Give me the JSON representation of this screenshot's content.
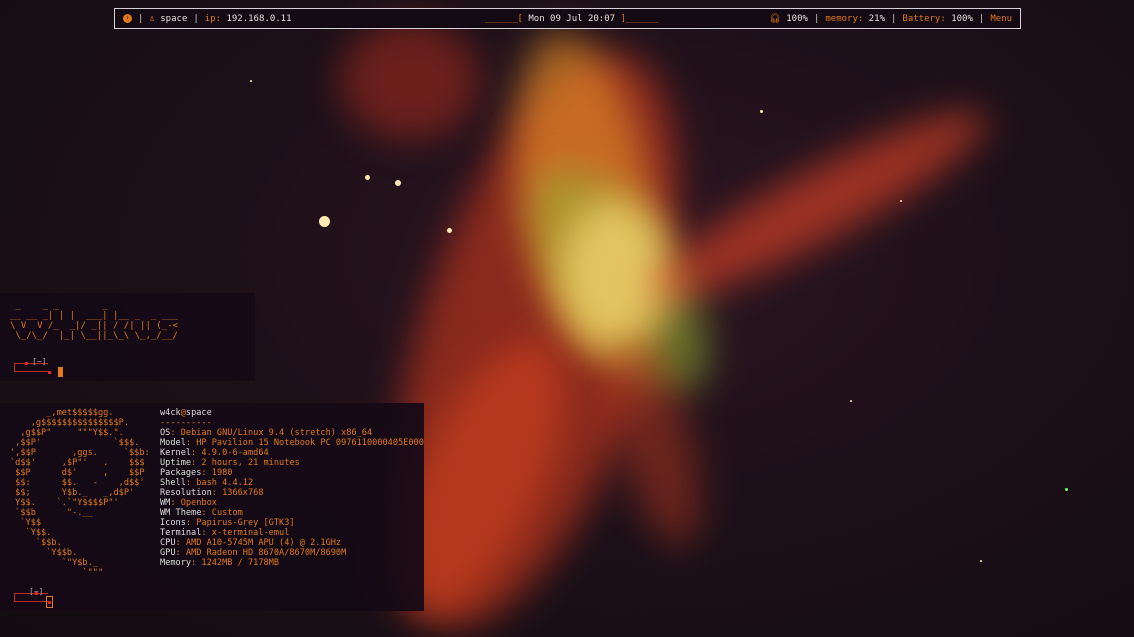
{
  "topbar": {
    "host": "space",
    "ip_label": "ip:",
    "ip": "192.168.0.11",
    "clock_left": "______[",
    "date": "Mon 09 Jul  20:07",
    "clock_right": "]______",
    "volume": "100%",
    "memory_label": "memory:",
    "memory": "21%",
    "battery_label": "Battery:",
    "battery": "100%",
    "menu": "Menu"
  },
  "terminal1": {
    "banner": " _    _ _        _              \n__ __ _| | |  ___| |__ _  _ ___ \n\\ V  V /_  _|/ _|| / /| || (_-< \n \\_/\\_/  |_| \\__||_\\_\\ \\_,_/__/ ",
    "prompt": "[~]"
  },
  "terminal2": {
    "logo": "       _,met$$$$$gg.\n    ,g$$$$$$$$$$$$$$$P.\n  ,g$$P\"     \"\"\"Y$$.\".\n ,$$P'              `$$$.\n',$$P       ,ggs.     `$$b:\n`d$$'     ,$P\"'   .    $$$\n $$P      d$'     ,    $$P\n $$:      $$.   -    ,d$$'\n $$;      Y$b._   _,d$P'\n Y$$.    `.`\"Y$$$$P\"'\n `$$b      \"-.__\n  `Y$$\n   `Y$$.\n     `$$b.\n       `Y$$b.\n          `\"Y$b._\n              `\"\"\"",
    "user": "w4ck",
    "at": "@",
    "host": "space",
    "dashes": "----------",
    "info": [
      {
        "k": "OS",
        "v": "Debian GNU/Linux 9.4 (stretch) x86_64"
      },
      {
        "k": "Model",
        "v": "HP Pavilion 15 Notebook PC 0976110000405E000"
      },
      {
        "k": "Kernel",
        "v": "4.9.0-6-amd64"
      },
      {
        "k": "Uptime",
        "v": "2 hours, 21 minutes"
      },
      {
        "k": "Packages",
        "v": "1980"
      },
      {
        "k": "Shell",
        "v": "bash 4.4.12"
      },
      {
        "k": "Resolution",
        "v": "1366x768"
      },
      {
        "k": "WM",
        "v": "Openbox"
      },
      {
        "k": "WM Theme",
        "v": "Custom"
      },
      {
        "k": "Icons",
        "v": "Papirus-Grey [GTK3]"
      },
      {
        "k": "Terminal",
        "v": "x-terminal-emul"
      },
      {
        "k": "CPU",
        "v": "AMD A10-5745M APU (4) @ 2.1GHz"
      },
      {
        "k": "GPU",
        "v": "AMD Radeon HD 8670A/8670M/8690M"
      },
      {
        "k": "Memory",
        "v": "1242MB / 7178MB"
      }
    ],
    "prompt": "[~]"
  },
  "colors": {
    "accent": "#e07a1c",
    "prompt": "#c02a2a"
  }
}
